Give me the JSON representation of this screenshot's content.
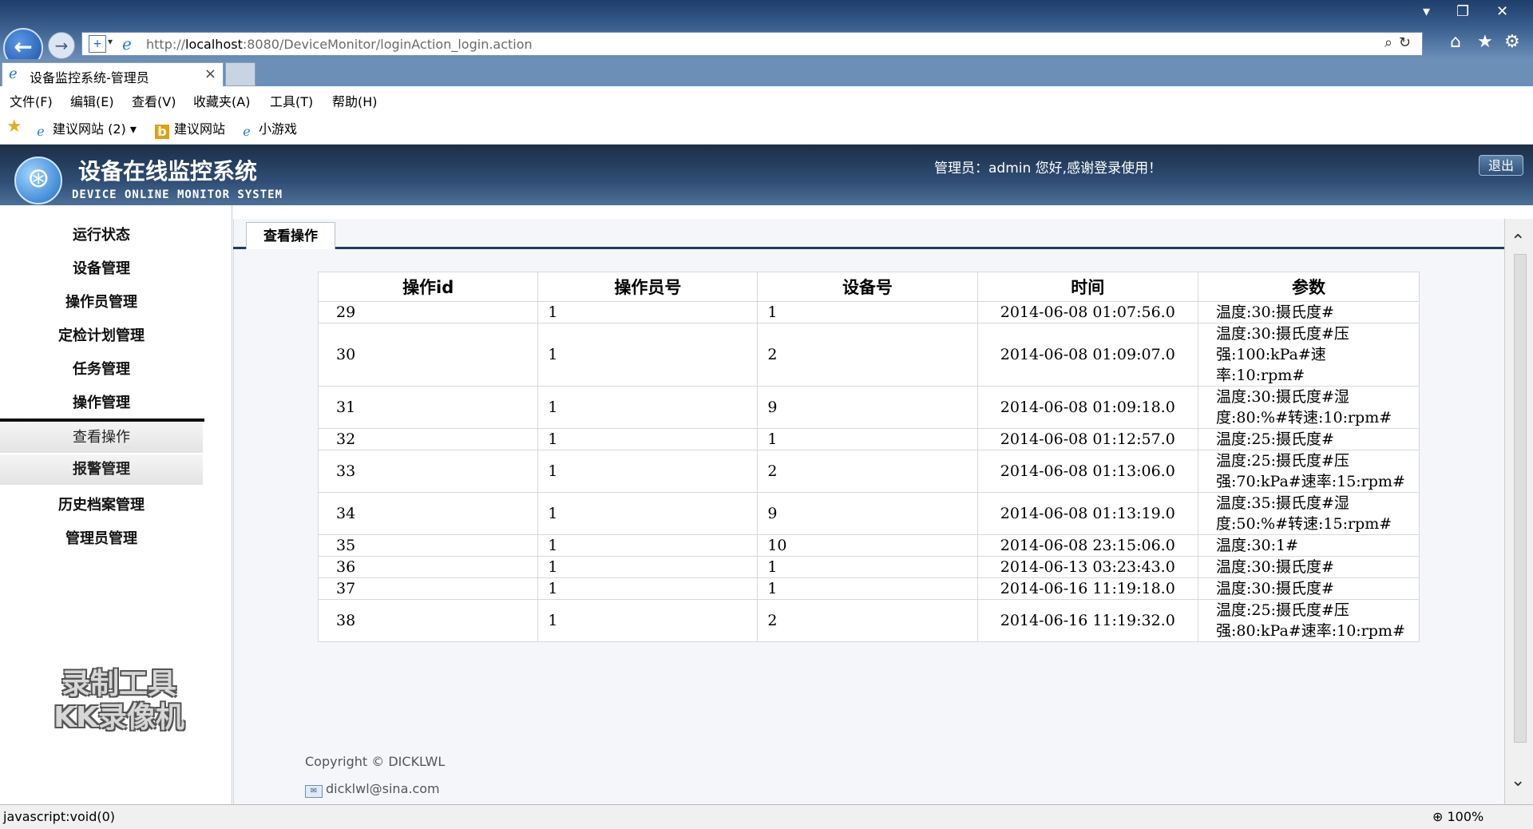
{
  "browser": {
    "url_prefix": "http://",
    "url_host": "localhost",
    "url_rest": ":8080/DeviceMonitor/loginAction_login.action",
    "tab_title": "设备监控系统-管理员",
    "menu": [
      "文件(F)",
      "编辑(E)",
      "查看(V)",
      "收藏夹(A)",
      "工具(T)",
      "帮助(H)"
    ],
    "favorites": [
      "建议网站 (2)",
      "建议网站",
      "小游戏"
    ],
    "status_text": "javascript:void(0)",
    "zoom": "100%"
  },
  "app": {
    "title": "设备在线监控系统",
    "subtitle": "DEVICE ONLINE MONITOR SYSTEM",
    "welcome": "管理员：admin 您好,感谢登录使用！",
    "logout_label": "退出"
  },
  "sidebar": {
    "items": [
      "运行状态",
      "设备管理",
      "操作员管理",
      "定检计划管理",
      "任务管理",
      "操作管理"
    ],
    "subitems": [
      "查看操作",
      "报警管理"
    ],
    "items_after": [
      "历史档案管理",
      "管理员管理"
    ]
  },
  "watermark": {
    "line1": "录制工具",
    "line2": "KK录像机"
  },
  "main": {
    "tab_label": "查看操作",
    "columns": [
      "操作id",
      "操作员号",
      "设备号",
      "时间",
      "参数"
    ],
    "rows": [
      {
        "id": "29",
        "operator": "1",
        "device": "1",
        "time": "2014-06-08 01:07:56.0",
        "params": [
          "温度:30:摄氏度#"
        ]
      },
      {
        "id": "30",
        "operator": "1",
        "device": "2",
        "time": "2014-06-08 01:09:07.0",
        "params": [
          "温度:30:摄氏度#压",
          "强:100:kPa#速",
          "率:10:rpm#"
        ]
      },
      {
        "id": "31",
        "operator": "1",
        "device": "9",
        "time": "2014-06-08 01:09:18.0",
        "params": [
          "温度:30:摄氏度#湿",
          "度:80:%#转速:10:rpm#"
        ]
      },
      {
        "id": "32",
        "operator": "1",
        "device": "1",
        "time": "2014-06-08 01:12:57.0",
        "params": [
          "温度:25:摄氏度#"
        ]
      },
      {
        "id": "33",
        "operator": "1",
        "device": "2",
        "time": "2014-06-08 01:13:06.0",
        "params": [
          "温度:25:摄氏度#压",
          "强:70:kPa#速率:15:rpm#"
        ]
      },
      {
        "id": "34",
        "operator": "1",
        "device": "9",
        "time": "2014-06-08 01:13:19.0",
        "params": [
          "温度:35:摄氏度#湿",
          "度:50:%#转速:15:rpm#"
        ]
      },
      {
        "id": "35",
        "operator": "1",
        "device": "10",
        "time": "2014-06-08 23:15:06.0",
        "params": [
          "温度:30:1#"
        ]
      },
      {
        "id": "36",
        "operator": "1",
        "device": "1",
        "time": "2014-06-13 03:23:43.0",
        "params": [
          "温度:30:摄氏度#"
        ]
      },
      {
        "id": "37",
        "operator": "1",
        "device": "1",
        "time": "2014-06-16 11:19:18.0",
        "params": [
          "温度:30:摄氏度#"
        ]
      },
      {
        "id": "38",
        "operator": "1",
        "device": "2",
        "time": "2014-06-16 11:19:32.0",
        "params": [
          "温度:25:摄氏度#压",
          "强:80:kPa#速率:10:rpm#"
        ]
      }
    ],
    "copyright": "Copyright © DICKLWL",
    "email": "dicklwl@sina.com"
  },
  "icons": [
    "back-arrow-icon",
    "forward-arrow-icon",
    "ie-icon",
    "refresh-icon",
    "search-icon",
    "home-icon",
    "star-icon",
    "gear-icon",
    "close-icon",
    "mail-icon"
  ]
}
